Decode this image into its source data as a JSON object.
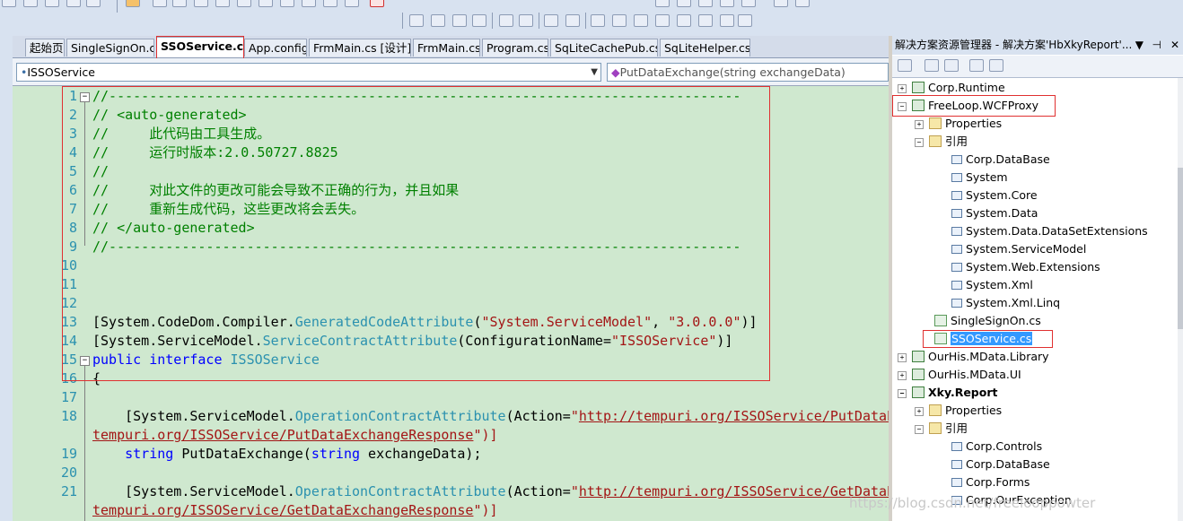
{
  "tabs": [
    {
      "label": "起始页",
      "active": false
    },
    {
      "label": "SingleSignOn.cs",
      "active": false
    },
    {
      "label": "SSOService.cs",
      "active": true
    },
    {
      "label": "App.config",
      "active": false
    },
    {
      "label": "FrmMain.cs [设计]",
      "active": false
    },
    {
      "label": "FrmMain.cs",
      "active": false
    },
    {
      "label": "Program.cs",
      "active": false
    },
    {
      "label": "SqLiteCachePub.cs",
      "active": false
    },
    {
      "label": "SqLiteHelper.cs",
      "active": false
    }
  ],
  "nav": {
    "type_combo": "ISSOService",
    "member_combo": "PutDataExchange(string exchangeData)"
  },
  "code": {
    "l1": {
      "n": "1",
      "text": "//------------------------------------------------------------------------------"
    },
    "l2": {
      "n": "2",
      "text": "// <auto-generated>"
    },
    "l3": {
      "n": "3",
      "text": "//     此代码由工具生成。"
    },
    "l4": {
      "n": "4",
      "text": "//     运行时版本:2.0.50727.8825"
    },
    "l5": {
      "n": "5",
      "text": "//"
    },
    "l6": {
      "n": "6",
      "text": "//     对此文件的更改可能会导致不正确的行为，并且如果"
    },
    "l7": {
      "n": "7",
      "text": "//     重新生成代码，这些更改将会丢失。"
    },
    "l8": {
      "n": "8",
      "text": "// </auto-generated>"
    },
    "l9": {
      "n": "9",
      "text": "//------------------------------------------------------------------------------"
    },
    "l10": {
      "n": "10"
    },
    "l11": {
      "n": "11"
    },
    "l12": {
      "n": "12"
    },
    "l13": {
      "n": "13",
      "a": "[System.CodeDom.Compiler.",
      "b": "GeneratedCodeAttribute",
      "c": "(",
      "d": "\"System.ServiceModel\"",
      "e": ", ",
      "f": "\"3.0.0.0\"",
      "g": ")]"
    },
    "l14": {
      "n": "14",
      "a": "[System.ServiceModel.",
      "b": "ServiceContractAttribute",
      "c": "(ConfigurationName=",
      "d": "\"ISSOService\"",
      "e": ")]"
    },
    "l15": {
      "n": "15",
      "a": "public",
      "b": " ",
      "c": "interface",
      "d": " ",
      "e": "ISSOService"
    },
    "l16": {
      "n": "16",
      "text": "{"
    },
    "l17": {
      "n": "17"
    },
    "l18": {
      "n": "18",
      "a": "    [System.ServiceModel.",
      "b": "OperationContractAttribute",
      "c": "(Action=",
      "d": "\"",
      "e": "http://tempuri.org/ISSOService/PutDataE"
    },
    "l18b": {
      "a": "tempuri.org/ISSOService/PutDataExchangeResponse",
      "b": "\")]"
    },
    "l19": {
      "n": "19",
      "a": "    ",
      "b": "string",
      "c": " PutDataExchange(",
      "d": "string",
      "e": " exchangeData);"
    },
    "l20": {
      "n": "20"
    },
    "l21": {
      "n": "21",
      "a": "    [System.ServiceModel.",
      "b": "OperationContractAttribute",
      "c": "(Action=",
      "d": "\"",
      "e": "http://tempuri.org/ISSOService/GetDataE"
    },
    "l21b": {
      "a": "tempuri.org/ISSOService/GetDataExchangeResponse",
      "b": "\")]"
    }
  },
  "solution_explorer": {
    "title": "解决方案资源管理器 - 解决方案'HbXkyReport'...",
    "items": [
      {
        "label": "Corp.Runtime",
        "bold": false
      },
      {
        "label": "FreeLoop.WCFProxy",
        "bold": false
      },
      {
        "label": "Properties",
        "bold": false
      },
      {
        "label": "引用",
        "bold": false
      },
      {
        "label": "Corp.DataBase",
        "bold": false
      },
      {
        "label": "System",
        "bold": false
      },
      {
        "label": "System.Core",
        "bold": false
      },
      {
        "label": "System.Data",
        "bold": false
      },
      {
        "label": "System.Data.DataSetExtensions",
        "bold": false
      },
      {
        "label": "System.ServiceModel",
        "bold": false
      },
      {
        "label": "System.Web.Extensions",
        "bold": false
      },
      {
        "label": "System.Xml",
        "bold": false
      },
      {
        "label": "System.Xml.Linq",
        "bold": false
      },
      {
        "label": "SingleSignOn.cs",
        "bold": false
      },
      {
        "label": "SSOService.cs",
        "bold": false
      },
      {
        "label": "OurHis.MData.Library",
        "bold": false
      },
      {
        "label": "OurHis.MData.UI",
        "bold": false
      },
      {
        "label": "Xky.Report",
        "bold": true
      },
      {
        "label": "Properties",
        "bold": false
      },
      {
        "label": "引用",
        "bold": false
      },
      {
        "label": "Corp.Controls",
        "bold": false
      },
      {
        "label": "Corp.DataBase",
        "bold": false
      },
      {
        "label": "Corp.Forms",
        "bold": false
      },
      {
        "label": "Corp.OurException",
        "bold": false
      }
    ]
  },
  "watermark": "https://blog.csdn.net/freelooppowter"
}
